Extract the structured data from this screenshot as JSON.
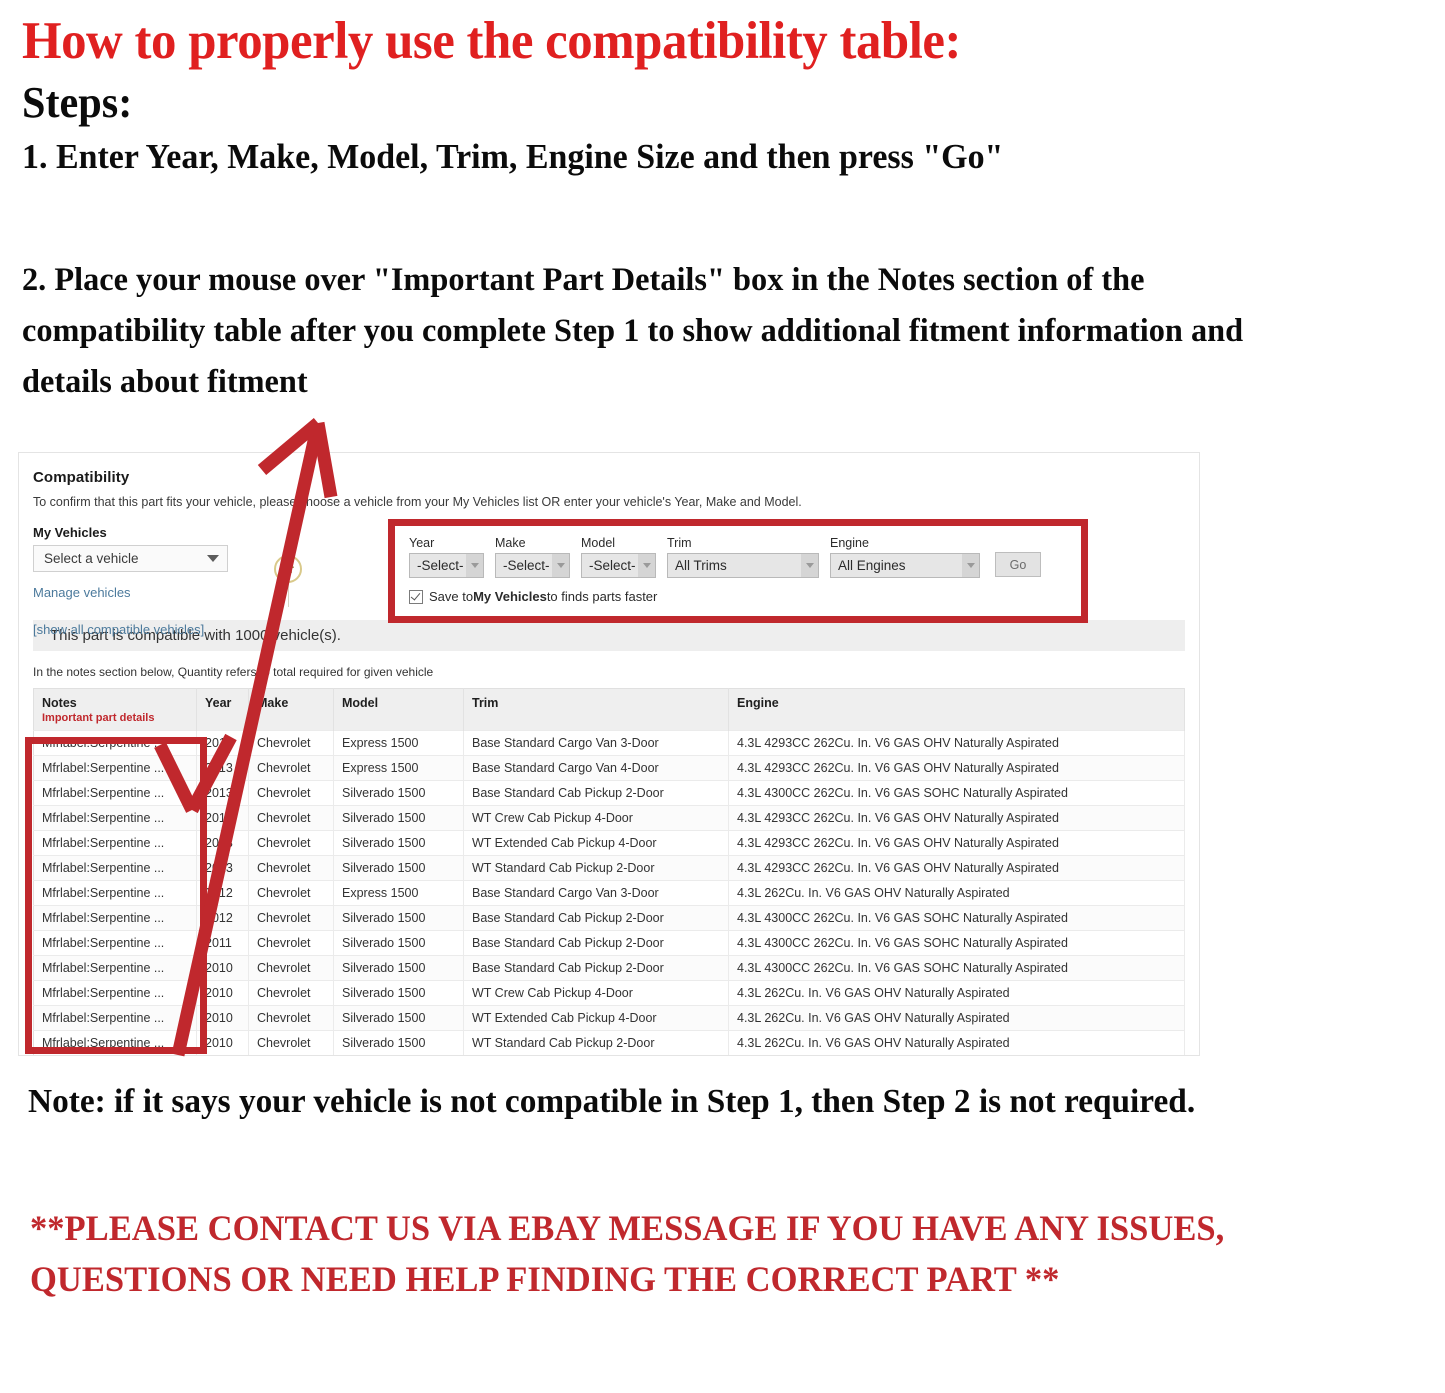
{
  "headline": {
    "title": "How to properly use the compatibility table:",
    "steps_label": "Steps:",
    "step_one": "1. Enter Year, Make, Model, Trim, Engine Size and then press \"Go\"",
    "step_two": "2. Place your mouse over \"Important Part Details\" box in the Notes section of the compatibility table after you complete Step 1 to show additional fitment information and details about fitment"
  },
  "compat": {
    "title": "Compatibility",
    "subtitle": "To confirm that this part fits your vehicle, please choose a vehicle from your My Vehicles list OR enter your vehicle's Year, Make and Model.",
    "my_vehicles_label": "My Vehicles",
    "my_vehicles_value": "Select a vehicle",
    "manage_vehicles_link": "Manage vehicles",
    "show_all_link": "[show all compatible vehicles]",
    "or_divider": "or",
    "banner": "This part is compatible with 1000 vehicle(s).",
    "notes_hint": "In the notes section below, Quantity refers to total required for given vehicle",
    "finder": {
      "year": {
        "label": "Year",
        "value": "-Select-"
      },
      "make": {
        "label": "Make",
        "value": "-Select-"
      },
      "model": {
        "label": "Model",
        "value": "-Select-"
      },
      "trim": {
        "label": "Trim",
        "value": "All Trims"
      },
      "engine": {
        "label": "Engine",
        "value": "All Engines"
      },
      "go_label": "Go",
      "save_prefix": "Save to ",
      "save_bold": "My Vehicles",
      "save_suffix": " to finds parts faster"
    },
    "table": {
      "headers": {
        "notes": "Notes",
        "notes_sub": "Important part details",
        "year": "Year",
        "make": "Make",
        "model": "Model",
        "trim": "Trim",
        "engine": "Engine"
      },
      "rows": [
        {
          "notes": "Mfrlabel:Serpentine ...",
          "year": "2013",
          "make": "Chevrolet",
          "model": "Express 1500",
          "trim": "Base Standard Cargo Van 3-Door",
          "engine": "4.3L 4293CC 262Cu. In. V6 GAS OHV Naturally Aspirated"
        },
        {
          "notes": "Mfrlabel:Serpentine ...",
          "year": "2013",
          "make": "Chevrolet",
          "model": "Express 1500",
          "trim": "Base Standard Cargo Van 4-Door",
          "engine": "4.3L 4293CC 262Cu. In. V6 GAS OHV Naturally Aspirated"
        },
        {
          "notes": "Mfrlabel:Serpentine ...",
          "year": "2013",
          "make": "Chevrolet",
          "model": "Silverado 1500",
          "trim": "Base Standard Cab Pickup 2-Door",
          "engine": "4.3L 4300CC 262Cu. In. V6 GAS SOHC Naturally Aspirated"
        },
        {
          "notes": "Mfrlabel:Serpentine ...",
          "year": "2013",
          "make": "Chevrolet",
          "model": "Silverado 1500",
          "trim": "WT Crew Cab Pickup 4-Door",
          "engine": "4.3L 4293CC 262Cu. In. V6 GAS OHV Naturally Aspirated"
        },
        {
          "notes": "Mfrlabel:Serpentine ...",
          "year": "2013",
          "make": "Chevrolet",
          "model": "Silverado 1500",
          "trim": "WT Extended Cab Pickup 4-Door",
          "engine": "4.3L 4293CC 262Cu. In. V6 GAS OHV Naturally Aspirated"
        },
        {
          "notes": "Mfrlabel:Serpentine ...",
          "year": "2013",
          "make": "Chevrolet",
          "model": "Silverado 1500",
          "trim": "WT Standard Cab Pickup 2-Door",
          "engine": "4.3L 4293CC 262Cu. In. V6 GAS OHV Naturally Aspirated"
        },
        {
          "notes": "Mfrlabel:Serpentine ...",
          "year": "2012",
          "make": "Chevrolet",
          "model": "Express 1500",
          "trim": "Base Standard Cargo Van 3-Door",
          "engine": "4.3L 262Cu. In. V6 GAS OHV Naturally Aspirated"
        },
        {
          "notes": "Mfrlabel:Serpentine ...",
          "year": "2012",
          "make": "Chevrolet",
          "model": "Silverado 1500",
          "trim": "Base Standard Cab Pickup 2-Door",
          "engine": "4.3L 4300CC 262Cu. In. V6 GAS SOHC Naturally Aspirated"
        },
        {
          "notes": "Mfrlabel:Serpentine ...",
          "year": "2011",
          "make": "Chevrolet",
          "model": "Silverado 1500",
          "trim": "Base Standard Cab Pickup 2-Door",
          "engine": "4.3L 4300CC 262Cu. In. V6 GAS SOHC Naturally Aspirated"
        },
        {
          "notes": "Mfrlabel:Serpentine ...",
          "year": "2010",
          "make": "Chevrolet",
          "model": "Silverado 1500",
          "trim": "Base Standard Cab Pickup 2-Door",
          "engine": "4.3L 4300CC 262Cu. In. V6 GAS SOHC Naturally Aspirated"
        },
        {
          "notes": "Mfrlabel:Serpentine ...",
          "year": "2010",
          "make": "Chevrolet",
          "model": "Silverado 1500",
          "trim": "WT Crew Cab Pickup 4-Door",
          "engine": "4.3L 262Cu. In. V6 GAS OHV Naturally Aspirated"
        },
        {
          "notes": "Mfrlabel:Serpentine ...",
          "year": "2010",
          "make": "Chevrolet",
          "model": "Silverado 1500",
          "trim": "WT Extended Cab Pickup 4-Door",
          "engine": "4.3L 262Cu. In. V6 GAS OHV Naturally Aspirated"
        },
        {
          "notes": "Mfrlabel:Serpentine ...",
          "year": "2010",
          "make": "Chevrolet",
          "model": "Silverado 1500",
          "trim": "WT Standard Cab Pickup 2-Door",
          "engine": "4.3L 262Cu. In. V6 GAS OHV Naturally Aspirated"
        }
      ]
    }
  },
  "footer": {
    "note": "Note: if it says your vehicle is not compatible in Step 1, then Step 2 is not required.",
    "contact": "**PLEASE CONTACT US VIA EBAY MESSAGE IF YOU HAVE ANY ISSUES, QUESTIONS OR NEED HELP FINDING THE CORRECT PART **"
  },
  "colors": {
    "accent_red": "#c0282d",
    "title_red": "#e02020",
    "link_blue": "#4c7a9c"
  }
}
